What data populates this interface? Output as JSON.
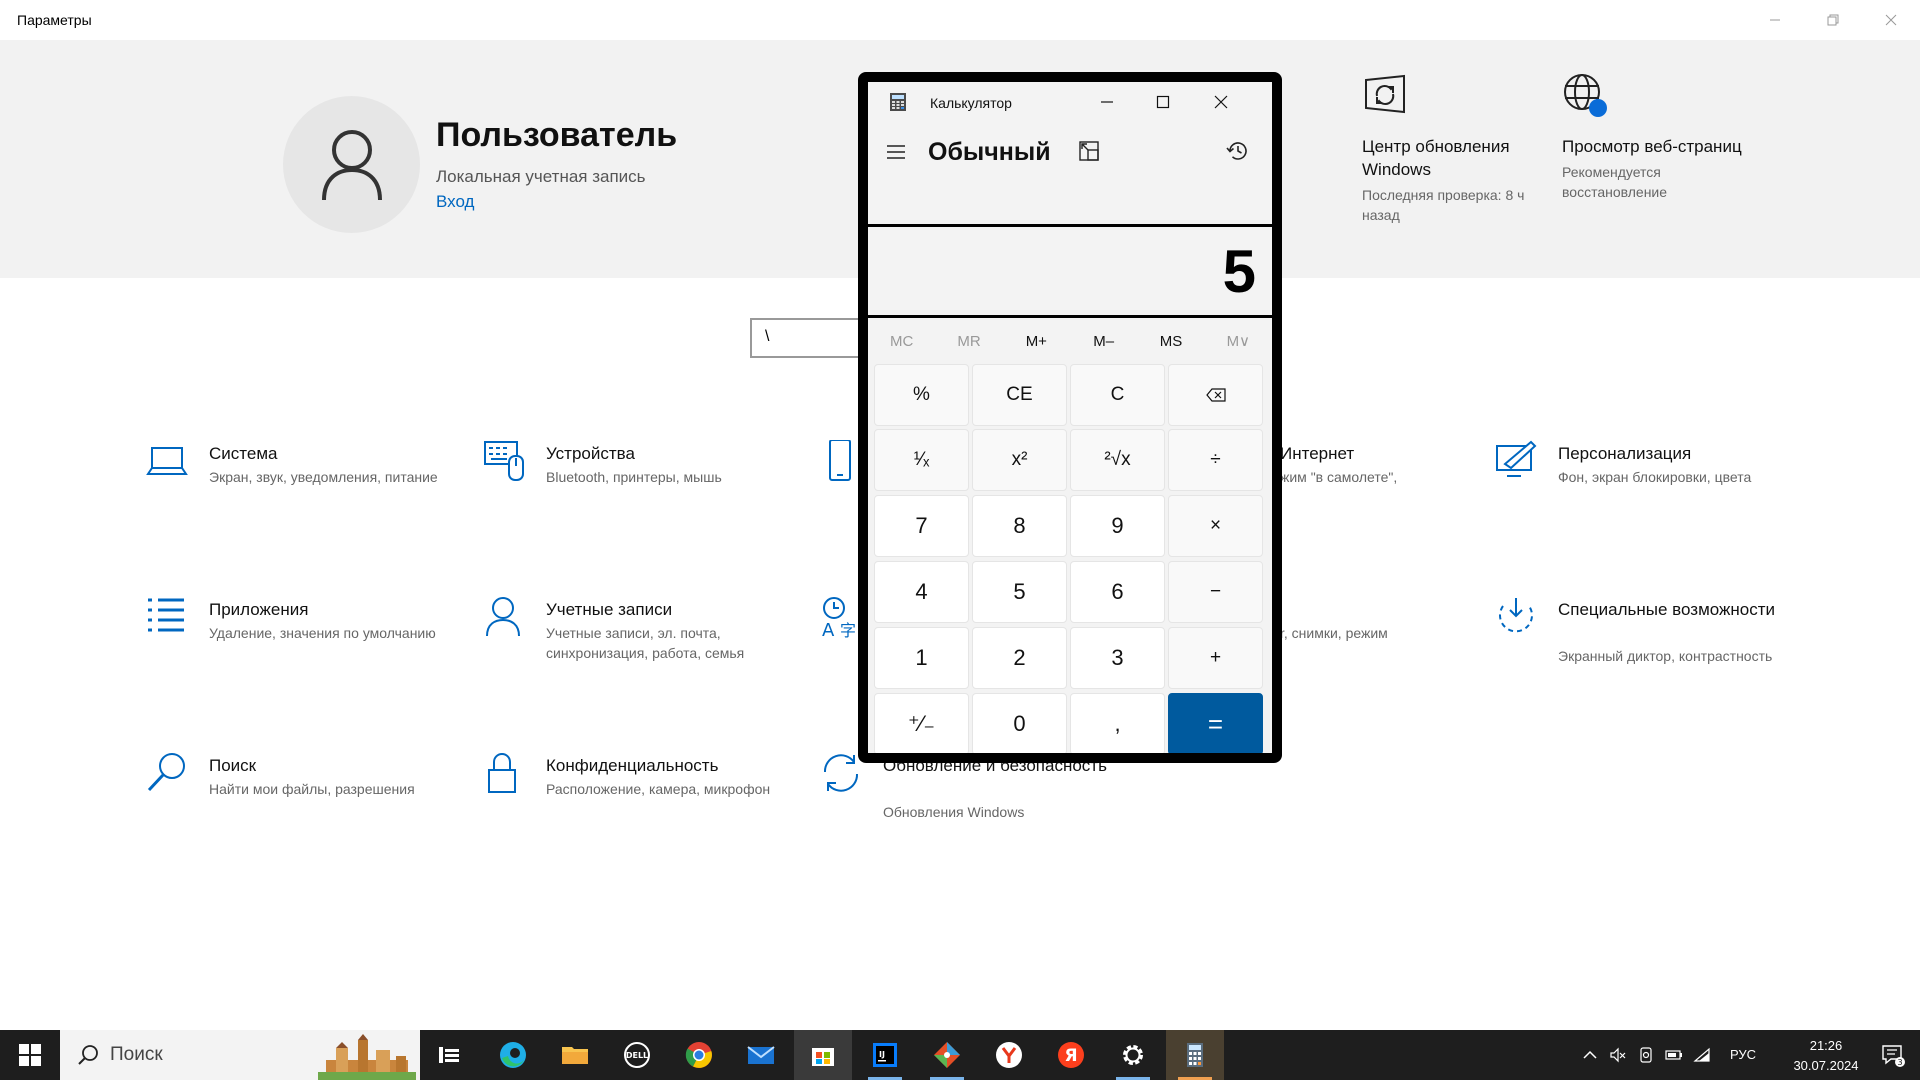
{
  "settings": {
    "window_title": "Параметры",
    "user": {
      "name": "Пользователь",
      "account_type": "Локальная учетная запись",
      "signin_link": "Вход"
    },
    "quick_tiles": [
      {
        "icon": "windows-update-icon",
        "title": "Центр обновления Windows",
        "subtitle": "Последняя проверка: 8 ч назад"
      },
      {
        "icon": "web-browsing-icon",
        "title": "Просмотр веб-страниц",
        "subtitle": "Рекомендуется восстановление"
      }
    ],
    "search_value": "\\",
    "categories": [
      {
        "icon": "laptop-icon",
        "title": "Система",
        "subtitle": "Экран, звук, уведомления, питание"
      },
      {
        "icon": "devices-icon",
        "title": "Устройства",
        "subtitle": "Bluetooth, принтеры, мышь"
      },
      {
        "icon": "phone-icon",
        "title": "",
        "subtitle": ""
      },
      {
        "icon": "globe-icon",
        "title": "Интернет",
        "subtitle": "жим \"в самолете\","
      },
      {
        "icon": "personalization-icon",
        "title": "Персонализация",
        "subtitle": "Фон, экран блокировки, цвета"
      },
      {
        "icon": "apps-icon",
        "title": "Приложения",
        "subtitle": "Удаление, значения по умолчанию"
      },
      {
        "icon": "accounts-icon",
        "title": "Учетные записи",
        "subtitle": "Учетные записи, эл. почта, синхронизация, работа, семья"
      },
      {
        "icon": "time-language-icon",
        "title": "",
        "subtitle": ""
      },
      {
        "icon": "gaming-icon",
        "title": "",
        "subtitle": "r, снимки, режим"
      },
      {
        "icon": "accessibility-icon",
        "title": "Специальные возможности",
        "subtitle": "Экранный диктор, контрастность"
      },
      {
        "icon": "search-icon",
        "title": "Поиск",
        "subtitle": "Найти мои файлы, разрешения"
      },
      {
        "icon": "lock-icon",
        "title": "Конфиденциальность",
        "subtitle": "Расположение, камера, микрофон"
      },
      {
        "icon": "update-security-icon",
        "title": "Обновление и безопасность",
        "subtitle": "Обновления Windows"
      }
    ]
  },
  "calculator": {
    "title": "Калькулятор",
    "mode": "Обычный",
    "display": "5",
    "memory": [
      {
        "label": "MC",
        "enabled": false
      },
      {
        "label": "MR",
        "enabled": false
      },
      {
        "label": "M+",
        "enabled": true
      },
      {
        "label": "M–",
        "enabled": true
      },
      {
        "label": "MS",
        "enabled": true
      },
      {
        "label": "M∨",
        "enabled": false
      }
    ],
    "keys": [
      [
        "%",
        "CE",
        "C",
        "⌫"
      ],
      [
        "¹⁄ₓ",
        "x²",
        "²√x",
        "÷"
      ],
      [
        "7",
        "8",
        "9",
        "×"
      ],
      [
        "4",
        "5",
        "6",
        "−"
      ],
      [
        "1",
        "2",
        "3",
        "+"
      ],
      [
        "⁺⁄₋",
        "0",
        ",",
        "="
      ]
    ],
    "accent_color": "#005a9e"
  },
  "taskbar": {
    "search_placeholder": "Поиск",
    "apps": [
      "task-view",
      "edge",
      "file-explorer",
      "dell",
      "chrome",
      "mail",
      "store",
      "intellij",
      "git-app",
      "yandex-browser",
      "yandex",
      "settings",
      "calculator"
    ],
    "language": "РУС",
    "time": "21:26",
    "date": "30.07.2024",
    "notification_count": "3"
  }
}
